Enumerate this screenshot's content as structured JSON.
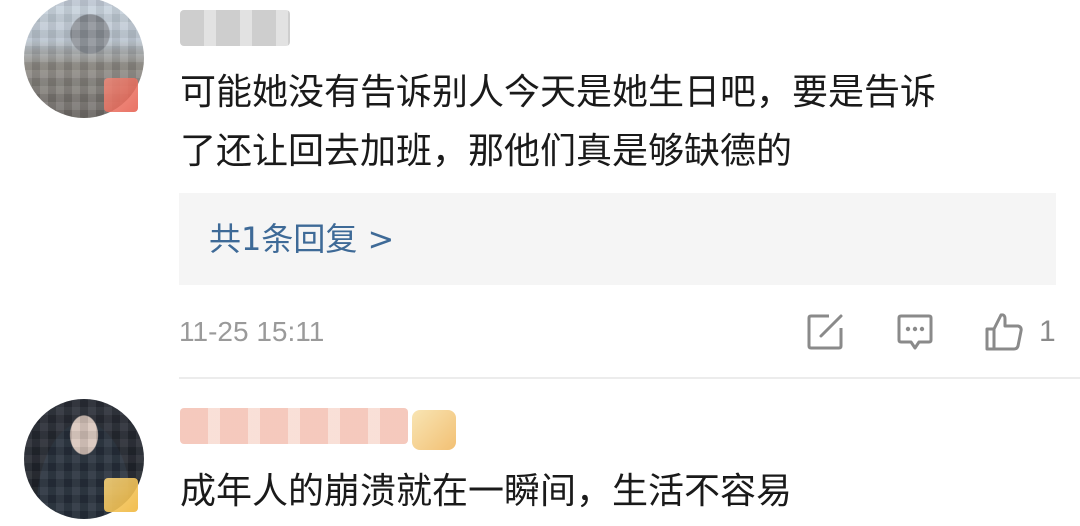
{
  "comments": [
    {
      "text_lines": [
        "可能她没有告诉别人今天是她生日吧，要是告诉",
        "了还让回去加班，那他们真是够缺德的"
      ],
      "reply_link": "共1条回复 >",
      "timestamp": "11-25 15:11",
      "actions": {
        "share_icon": "edit-share-icon",
        "comment_icon": "comment-icon",
        "like_icon": "thumbs-up-icon",
        "like_count": "1"
      }
    },
    {
      "text_lines": [
        "成年人的崩溃就在一瞬间，生活不容易"
      ]
    }
  ],
  "colors": {
    "link_blue": "#3e6a97",
    "meta_gray": "#9a9a9a",
    "reply_bg": "#f5f5f5"
  }
}
